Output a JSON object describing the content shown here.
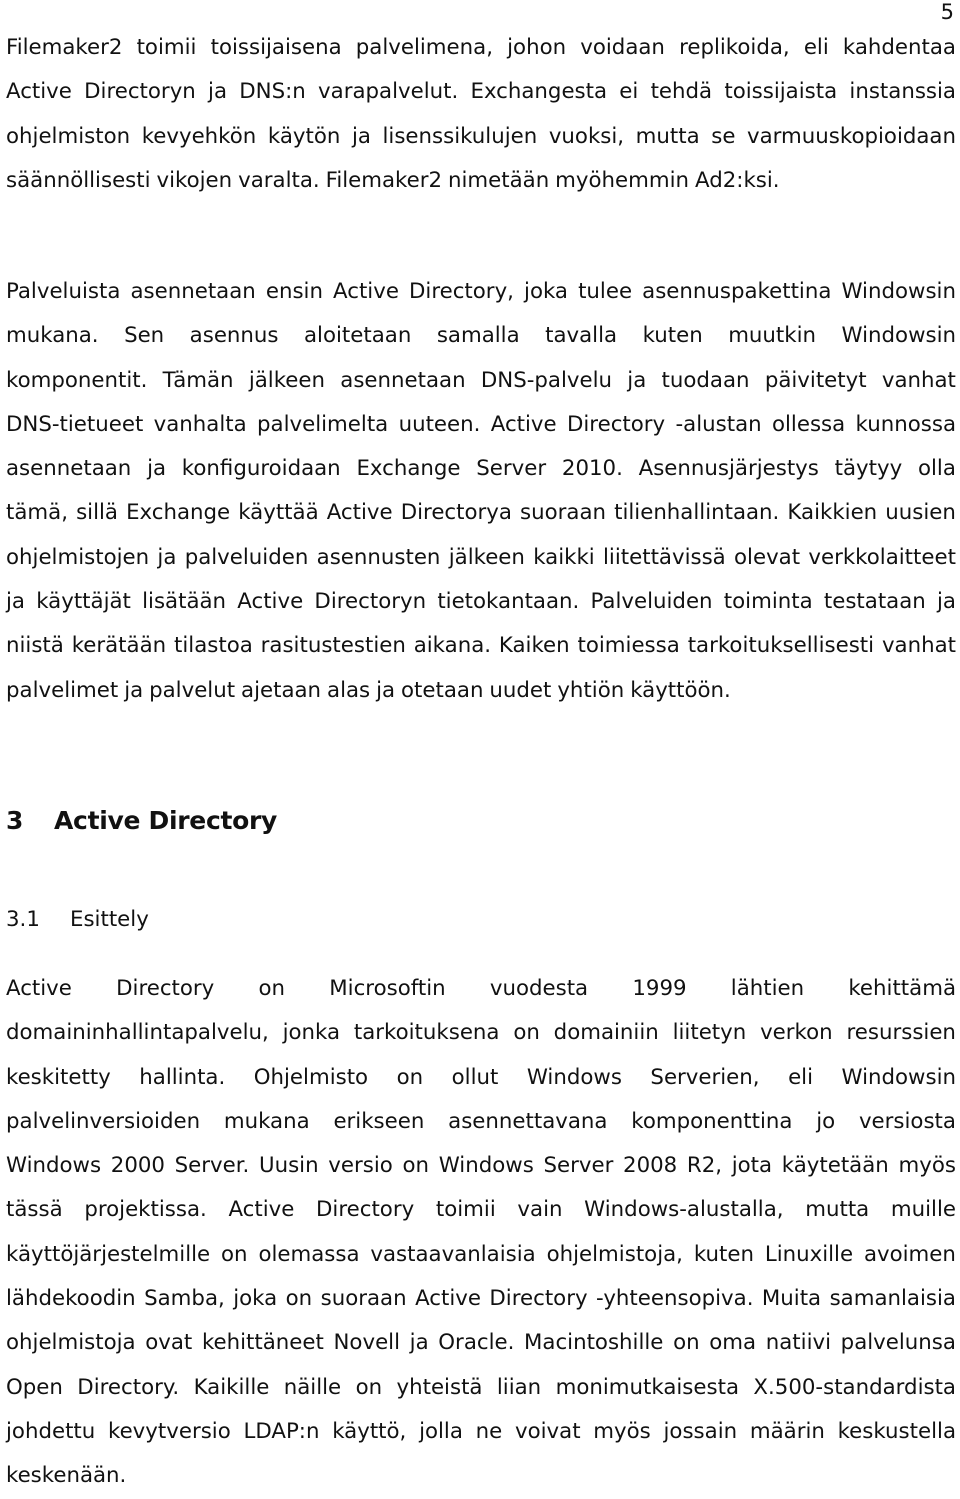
{
  "page_number": "5",
  "paragraphs": [
    {
      "lines": [
        "Filemaker2 toimii toissijaisena palvelimena, johon voidaan replikoida, eli kahdentaa",
        "Active Directoryn ja DNS:n varapalvelut. Exchangesta ei tehdä toissijaista instanssia",
        "ohjelmiston kevyehkön käytön ja lisenssikulujen vuoksi, mutta se varmuuskopioidaan",
        "säännöllisesti vikojen varalta. Filemaker2 nimetään myöhemmin Ad2:ksi."
      ]
    },
    {
      "lines": [
        "Palveluista asennetaan ensin Active Directory, joka tulee asennuspakettina Windowsin",
        "mukana. Sen asennus aloitetaan samalla tavalla kuten muutkin Windowsin",
        "komponentit. Tämän jälkeen asennetaan DNS-palvelu ja tuodaan päivitetyt vanhat",
        "DNS-tietueet vanhalta palvelimelta uuteen. Active Directory -alustan ollessa kunnossa",
        "asennetaan ja konfiguroidaan Exchange Server 2010. Asennusjärjestys täytyy olla",
        "tämä, sillä Exchange käyttää Active Directorya suoraan tilienhallintaan. Kaikkien uusien",
        "ohjelmistojen ja palveluiden asennusten jälkeen kaikki liitettävissä olevat verkkolaitteet",
        "ja käyttäjät lisätään Active Directoryn tietokantaan. Palveluiden toiminta testataan ja",
        "niistä kerätään tilastoa rasitustestien aikana. Kaiken toimiessa tarkoituksellisesti vanhat",
        "palvelimet ja palvelut ajetaan alas ja otetaan uudet yhtiön käyttöön."
      ]
    },
    {
      "lines": [
        "Active Directory on Microsoftin vuodesta 1999 lähtien kehittämä",
        "domaininhallintapalvelu, jonka tarkoituksena on domainiin liitetyn verkon resurssien",
        "keskitetty hallinta. Ohjelmisto on ollut Windows Serverien, eli Windowsin",
        "palvelinversioiden mukana erikseen asennettavana komponenttina jo versiosta",
        "Windows 2000 Server. Uusin versio on Windows Server 2008 R2, jota käytetään myös",
        "tässä projektissa. Active Directory toimii vain Windows-alustalla, mutta muille",
        "käyttöjärjestelmille on olemassa vastaavanlaisia ohjelmistoja, kuten Linuxille avoimen",
        "lähdekoodin Samba, joka on suoraan Active Directory -yhteensopiva. Muita samanlaisia",
        "ohjelmistoja ovat kehittäneet Novell ja Oracle. Macintoshille on oma natiivi palvelunsa",
        "Open Directory. Kaikille näille on yhteistä liian monimutkaisesta X.500-standardista",
        "johdettu kevytversio LDAP:n käyttö, jolla ne voivat myös jossain määrin keskustella",
        "keskenään."
      ]
    }
  ],
  "heading_1": {
    "number": "3",
    "title": "Active Directory"
  },
  "heading_2": {
    "number": "3.1",
    "title": "Esittely"
  }
}
